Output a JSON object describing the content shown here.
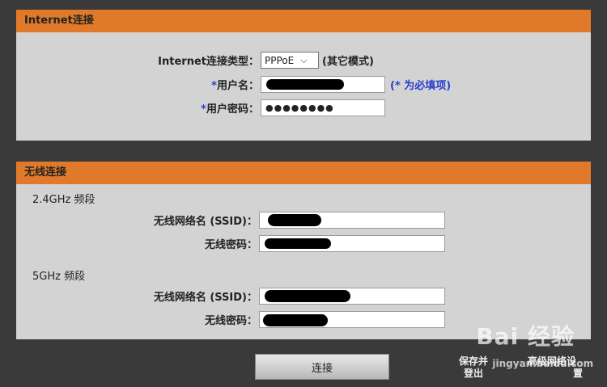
{
  "internet": {
    "header": "Internet连接",
    "conn_type_label": "Internet连接类型：",
    "conn_type_value": "PPPoE",
    "conn_type_mode": "(其它模式)",
    "required_star": "*",
    "username_label": "用户名：",
    "password_label": "用户密码：",
    "password_dots": "●●●●●●●●",
    "required_hint": "(* 为必填项)"
  },
  "wireless": {
    "header": "无线连接",
    "band24_label": "2.4GHz 频段",
    "band5_label": "5GHz 频段",
    "ssid_label": "无线网络名 (SSID)：",
    "wifi_password_label": "无线密码："
  },
  "actions": {
    "connect": "连接",
    "save_logout_line1": "保存并",
    "save_logout_line2": "登出",
    "advanced_line1": "高级网络设",
    "advanced_line2": "置"
  },
  "watermark": {
    "text": "Bai 经验",
    "sub": "jingyan.baidu.com"
  },
  "colors": {
    "accent": "#e07a2a",
    "panel": "#d3d3d3",
    "background": "#3a3a3a",
    "required": "#2a3fd0"
  }
}
